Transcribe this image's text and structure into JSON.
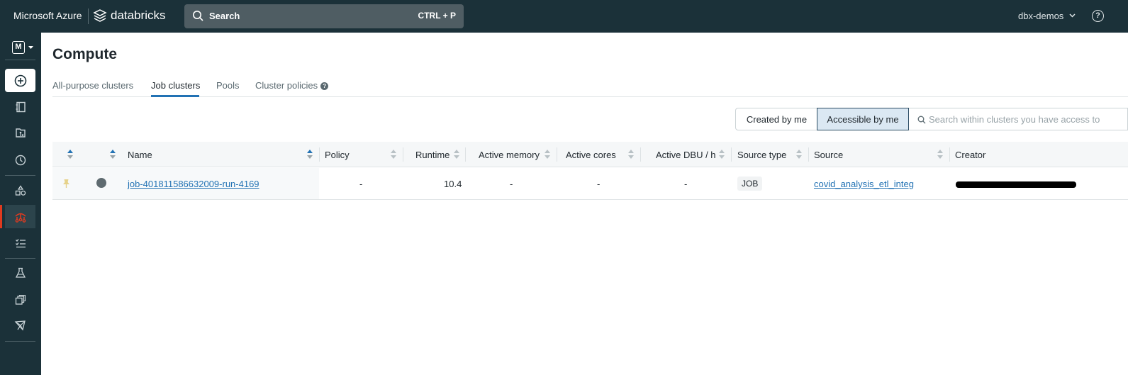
{
  "topbar": {
    "brand": "Microsoft Azure",
    "product": "databricks",
    "search_label": "Search",
    "search_shortcut": "CTRL + P",
    "workspace": "dbx-demos",
    "help_glyph": "?"
  },
  "sidebar": {
    "persona_letter": "M",
    "items": [
      {
        "name": "new",
        "icon": "plus-circle-icon"
      },
      {
        "name": "workspace",
        "icon": "notebook-icon"
      },
      {
        "name": "repos",
        "icon": "repo-icon"
      },
      {
        "name": "recents",
        "icon": "clock-icon"
      },
      {
        "name": "data",
        "icon": "shapes-icon"
      },
      {
        "name": "compute",
        "icon": "compute-icon",
        "active": true
      },
      {
        "name": "workflows",
        "icon": "tasks-icon"
      },
      {
        "name": "experiments",
        "icon": "flask-icon"
      },
      {
        "name": "feature-store",
        "icon": "layers-icon"
      },
      {
        "name": "models",
        "icon": "models-icon"
      }
    ],
    "active_color": "#e03a1f"
  },
  "page": {
    "title": "Compute",
    "tabs": [
      {
        "label": "All-purpose clusters"
      },
      {
        "label": "Job clusters",
        "active": true
      },
      {
        "label": "Pools"
      },
      {
        "label": "Cluster policies"
      }
    ]
  },
  "filters": {
    "created_by_me": "Created by me",
    "accessible_by_me": "Accessible by me",
    "search_placeholder": "Search within clusters you have access to"
  },
  "table": {
    "columns": [
      "Name",
      "Policy",
      "Runtime",
      "Active memory",
      "Active cores",
      "Active DBU / h",
      "Source type",
      "Source",
      "Creator"
    ],
    "rows": [
      {
        "name": "job-401811586632009-run-4169",
        "policy": "-",
        "runtime": "10.4",
        "active_memory": "-",
        "active_cores": "-",
        "active_dbu": "-",
        "source_type": "JOB",
        "source": "covid_analysis_etl_integ",
        "creator": "redacted"
      }
    ]
  },
  "colors": {
    "topbar_bg": "#1b3139",
    "link": "#2272b4",
    "tab_underline": "#2272b4"
  }
}
